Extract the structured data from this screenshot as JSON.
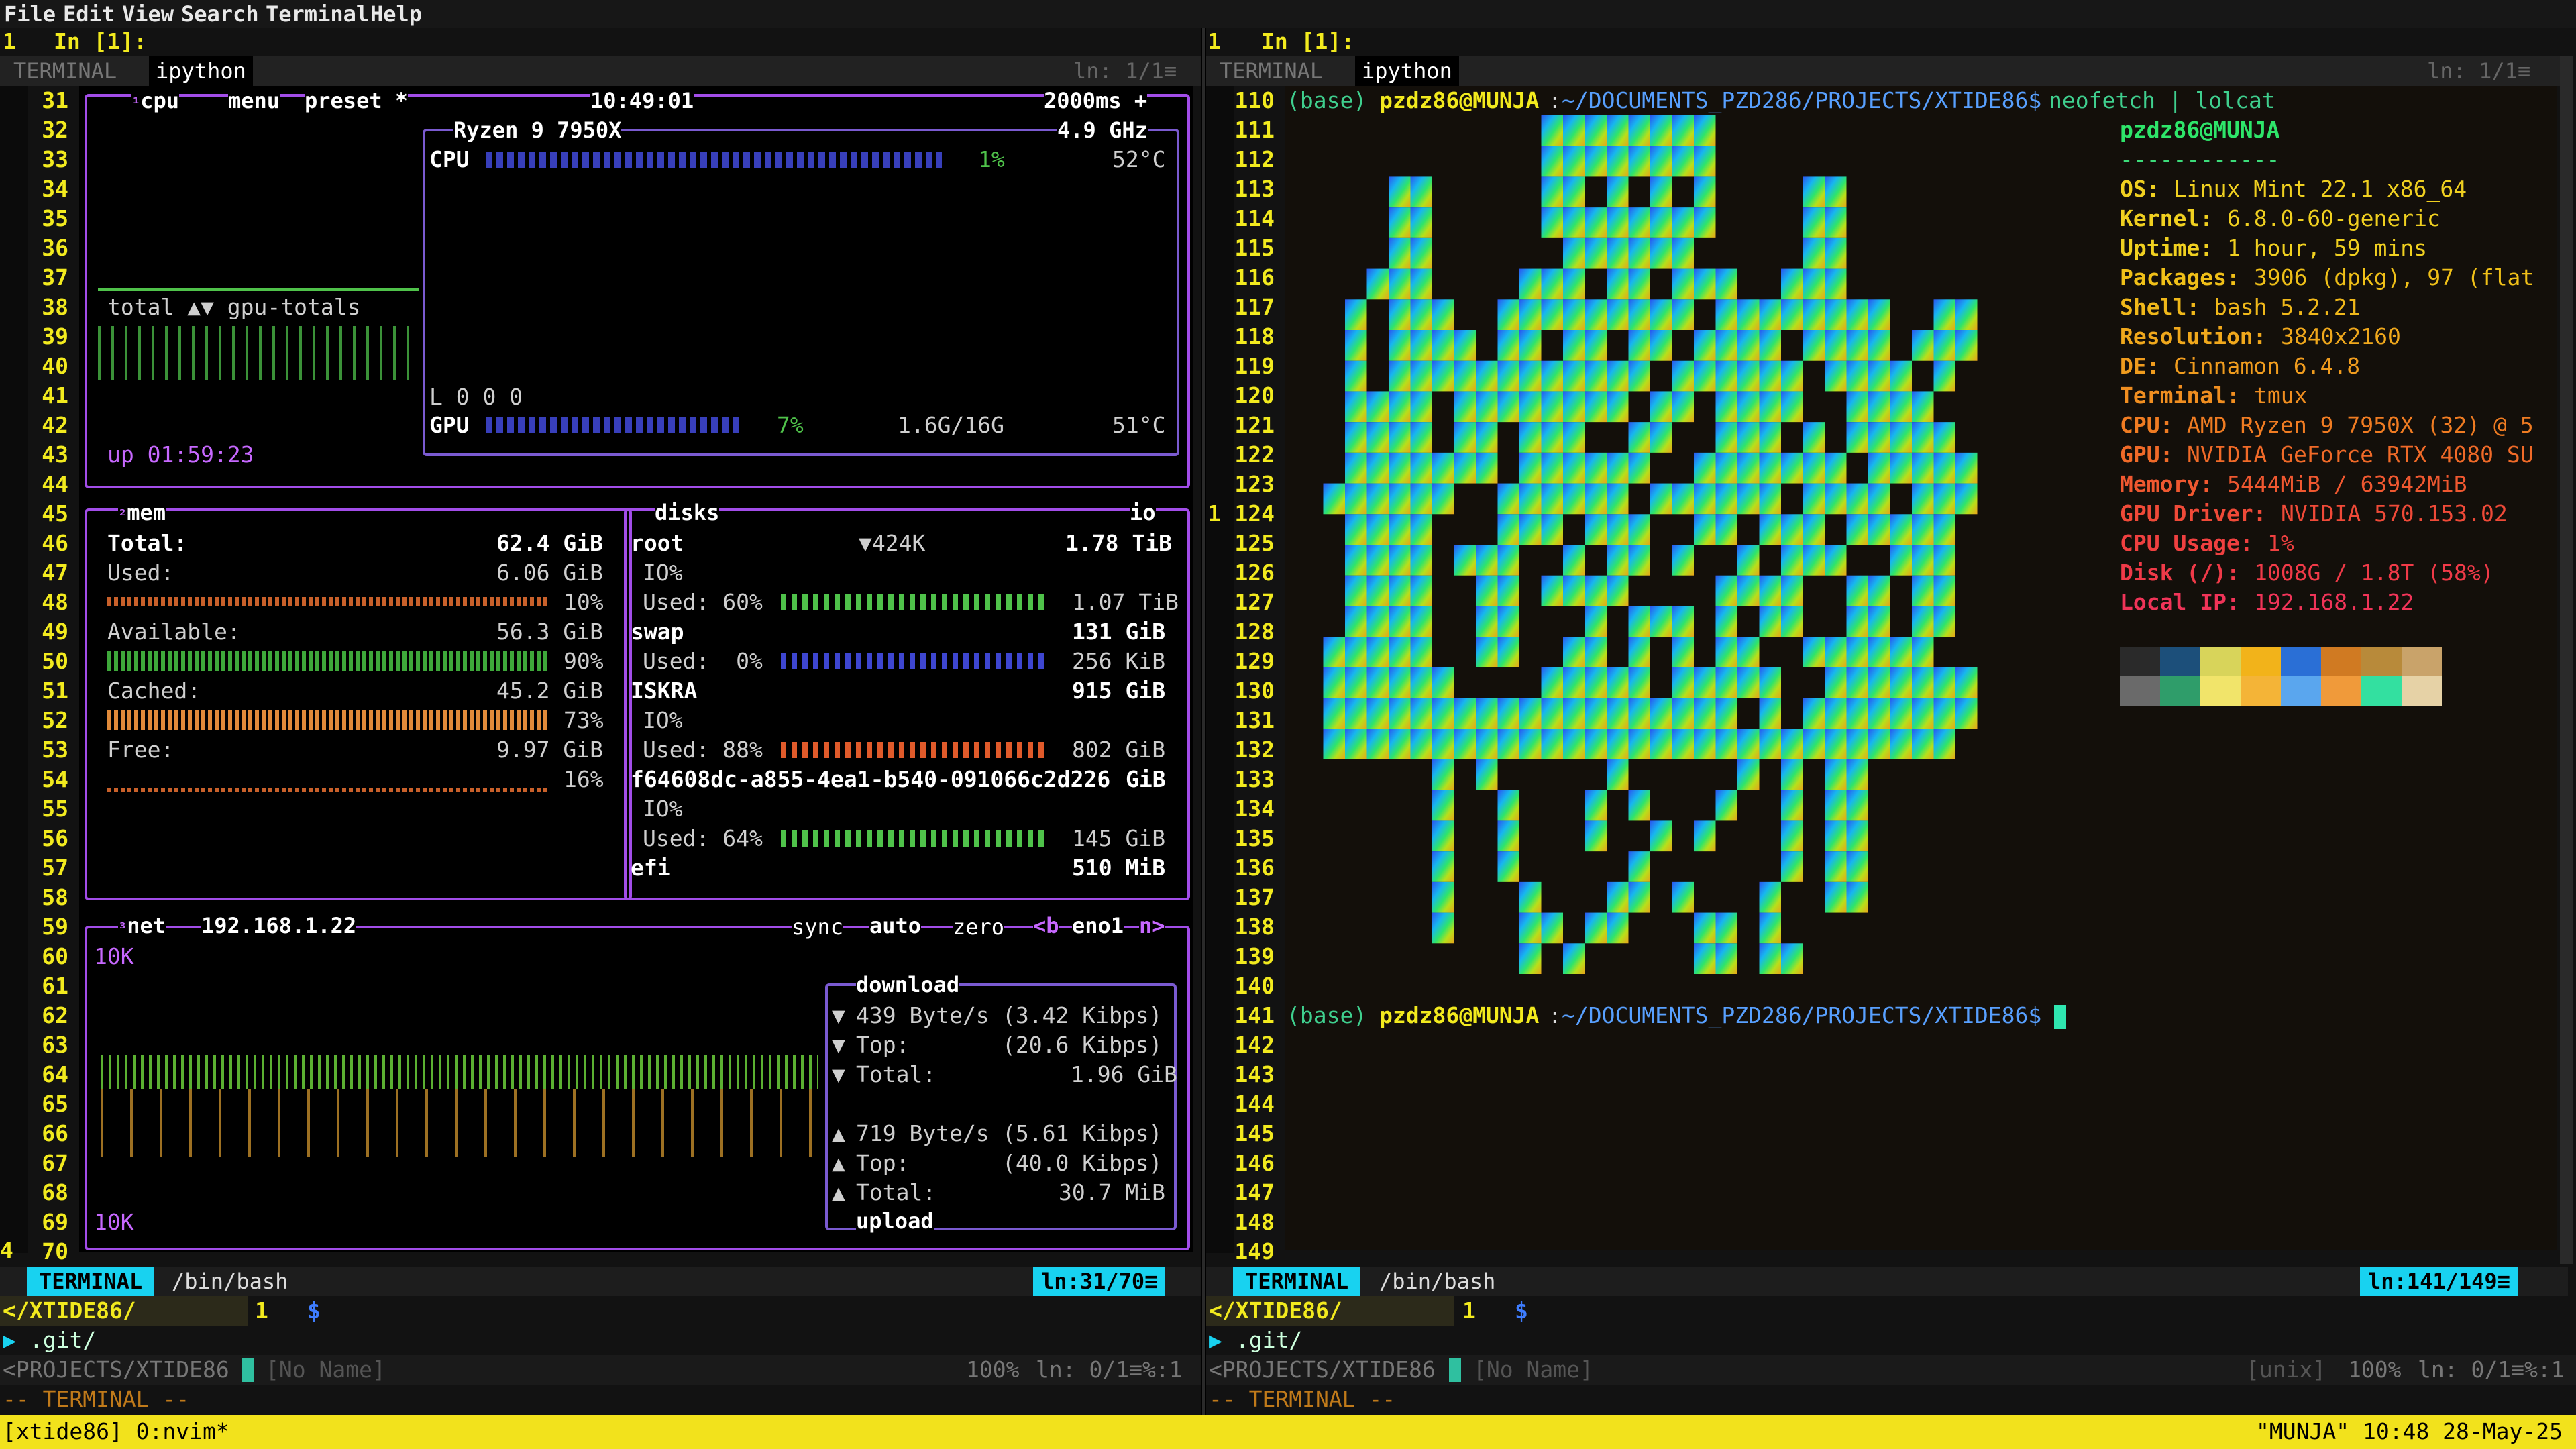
{
  "menubar": {
    "items": [
      "File",
      "Edit",
      "View",
      "Search",
      "Terminal",
      "Help"
    ]
  },
  "left": {
    "header": {
      "num": "1",
      "cmd": "In [1]:"
    },
    "tabs": {
      "t1": "TERMINAL",
      "t2": "ipython",
      "pos": "ln: 1/1≡"
    },
    "line_numbers": [
      "31",
      "32",
      "33",
      "34",
      "35",
      "36",
      "37",
      "38",
      "39",
      "40",
      "41",
      "42",
      "43",
      "44",
      "45",
      "46",
      "47",
      "48",
      "49",
      "50",
      "51",
      "52",
      "53",
      "54",
      "55",
      "56",
      "57",
      "58",
      "59",
      "60",
      "61",
      "62",
      "63",
      "64",
      "65",
      "66",
      "67",
      "68",
      "69",
      "70"
    ],
    "line_number_4": "4",
    "btop": {
      "cpu_title": "cpu",
      "menu": "menu",
      "preset": "preset *",
      "clock": "10:49:01",
      "interval": "2000ms +",
      "cpu_model": "Ryzen 9 7950X",
      "freq": "4.9 GHz",
      "cpu_label": "CPU",
      "cpu_pct": "1%",
      "cpu_temp": "52°C",
      "cpu_load": 0.01,
      "totals": "total ▲▼ gpu-totals",
      "load": "L 0 0 0",
      "gpu_label": "GPU",
      "gpu_pct": "7%",
      "gpu_mem": "1.6G/16G",
      "gpu_temp": "51°C",
      "gpu_load": 0.07,
      "uptime": "up 01:59:23",
      "mem": {
        "title": "mem",
        "total_label": "Total:",
        "total": "62.4 GiB",
        "used_label": "Used:",
        "used": "6.06 GiB",
        "used_pct": "10%",
        "avail_label": "Available:",
        "avail": "56.3 GiB",
        "avail_pct": "90%",
        "cached_label": "Cached:",
        "cached": "45.2 GiB",
        "cached_pct": "73%",
        "free_label": "Free:",
        "free": "9.97 GiB",
        "free_pct": "16%"
      },
      "disks": {
        "title": "disks",
        "io": "io",
        "root": "root",
        "root_io": "▼424K",
        "root_size": "1.78 TiB",
        "root_io_label": "IO%",
        "root_used": "Used: 60%",
        "root_used_val": "1.07 TiB",
        "root_frac": 0.6,
        "swap": "swap",
        "swap_size": "131 GiB",
        "swap_used": "Used:  0%",
        "swap_used_val": "256 KiB",
        "iskra": "ISKRA",
        "iskra_size": "915 GiB",
        "iskra_io_label": "IO%",
        "iskra_used": "Used: 88%",
        "iskra_used_val": "802 GiB",
        "iskra_frac": 0.88,
        "uuid": "f64608dc-a855-4ea1-b540-091066c2d226",
        "uuid_size": "GiB",
        "uuid_io_label": "IO%",
        "uuid_used": "Used: 64%",
        "uuid_used_val": "145 GiB",
        "uuid_frac": 0.64,
        "efi": "efi",
        "efi_size": "510 MiB"
      },
      "net": {
        "title": "net",
        "ip": "192.168.1.22",
        "sync": "sync",
        "auto": "auto",
        "zero": "zero",
        "iface_prev": "<b",
        "iface": "eno1",
        "iface_next": "n>",
        "scale_top": "10K",
        "scale_bottom": "10K",
        "download": "download",
        "dl_rate": "439 Byte/s",
        "dl_rate_k": "(3.42 Kibps)",
        "dl_top_label": "Top:",
        "dl_top": "(20.6 Kibps)",
        "dl_total_label": "Total:",
        "dl_total": "1.96 GiB",
        "ul_rate": "719 Byte/s",
        "ul_rate_k": "(5.61 Kibps)",
        "ul_top_label": "Top:",
        "ul_top": "(40.0 Kibps)",
        "ul_total_label": "Total:",
        "ul_total": "30.7 MiB",
        "upload": "upload"
      }
    },
    "status": {
      "mode": "TERMINAL",
      "path": "/bin/bash",
      "pos": "ln:31/70≡"
    },
    "bottom": {
      "dir": "</XTIDE86/",
      "num": "1",
      "dollar": "$",
      "git": ".git/",
      "path": "<PROJECTS/XTIDE86",
      "noname": "[No Name]",
      "pct": "100%",
      "pos": "ln: 0/1≡%:1",
      "mode": "-- TERMINAL --"
    }
  },
  "right": {
    "header": {
      "num": "1",
      "cmd": "In [1]:"
    },
    "tabs": {
      "t1": "TERMINAL",
      "t2": "ipython",
      "pos": "ln: 1/1≡"
    },
    "line_numbers": [
      "110",
      "111",
      "112",
      "113",
      "114",
      "115",
      "116",
      "117",
      "118",
      "119",
      "120",
      "121",
      "122",
      "123",
      "124",
      "125",
      "126",
      "127",
      "128",
      "129",
      "130",
      "131",
      "132",
      "133",
      "134",
      "135",
      "136",
      "137",
      "138",
      "139",
      "140",
      "141",
      "142",
      "143",
      "144",
      "145",
      "146",
      "147",
      "148",
      "149"
    ],
    "gutter_mark": "1",
    "prompt1": {
      "env": "(base)",
      "user": "pzdz86@MUNJA",
      "path": "~/DOCUMENTS_PZD286/PROJECTS/XTIDE86$",
      "cmd": "neofetch | lolcat"
    },
    "prompt2": {
      "env": "(base)",
      "user": "pzdz86@MUNJA",
      "path": "~/DOCUMENTS_PZD286/PROJECTS/XTIDE86$"
    },
    "neofetch": {
      "userhost": "pzdz86@MUNJA",
      "sep": "------------",
      "rows": [
        {
          "k": "OS",
          "v": "Linux Mint 22.1 x86_64"
        },
        {
          "k": "Kernel",
          "v": "6.8.0-60-generic"
        },
        {
          "k": "Uptime",
          "v": "1 hour, 59 mins"
        },
        {
          "k": "Packages",
          "v": "3906 (dpkg), 97 (flat"
        },
        {
          "k": "Shell",
          "v": "bash 5.2.21"
        },
        {
          "k": "Resolution",
          "v": "3840x2160"
        },
        {
          "k": "DE",
          "v": "Cinnamon 6.4.8"
        },
        {
          "k": "Terminal",
          "v": "tmux"
        },
        {
          "k": "CPU",
          "v": "AMD Ryzen 9 7950X (32) @ 5"
        },
        {
          "k": "GPU",
          "v": "NVIDIA GeForce RTX 4080 SU"
        },
        {
          "k": "Memory",
          "v": "5444MiB / 63942MiB"
        },
        {
          "k": "GPU Driver",
          "v": "NVIDIA 570.153.02"
        },
        {
          "k": "CPU Usage",
          "v": "1%"
        },
        {
          "k": "Disk (/)",
          "v": "1008G / 1.8T (58%)"
        },
        {
          "k": "Local IP",
          "v": "192.168.1.22"
        }
      ],
      "palette": [
        "#2a2a2a",
        "#1c4f7a",
        "#d8d45a",
        "#f2b31a",
        "#2a6fd6",
        "#d07a22",
        "#b88a3a",
        "#c9a36a",
        "#6a6a6a",
        "#2f9d6a",
        "#f1e46a",
        "#f4b437",
        "#5aa6ee",
        "#f09a3a",
        "#33e0a0",
        "#e6d2a6"
      ]
    },
    "status": {
      "mode": "TERMINAL",
      "path": "/bin/bash",
      "pos": "ln:141/149≡"
    },
    "bottom": {
      "dir": "</XTIDE86/",
      "num": "1",
      "dollar": "$",
      "git": ".git/",
      "path": "<PROJECTS/XTIDE86",
      "noname": "[No Name]",
      "unix": "[unix]",
      "pct": "100%",
      "pos": "ln: 0/1≡%:1",
      "mode": "-- TERMINAL --"
    }
  },
  "tmux": {
    "session": "[xtide86] 0:nvim*",
    "right": "\"MUNJA\" 10:48 28-May-25"
  },
  "colors": {
    "accent": "#a24de8",
    "line_numbers": "#f2ea1e",
    "status_cyan": "#18d2f0",
    "tmux_bar": "#f2e21c"
  }
}
